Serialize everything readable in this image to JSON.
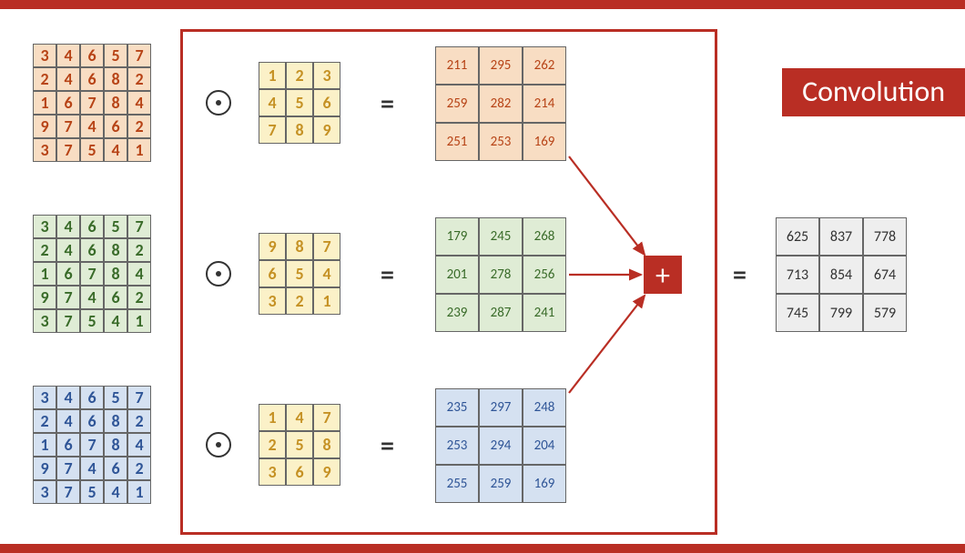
{
  "title": "Convolution",
  "inputs": {
    "channel1": [
      [
        3,
        4,
        6,
        5,
        7
      ],
      [
        2,
        4,
        6,
        8,
        2
      ],
      [
        1,
        6,
        7,
        8,
        4
      ],
      [
        9,
        7,
        4,
        6,
        2
      ],
      [
        3,
        7,
        5,
        4,
        1
      ]
    ],
    "channel2": [
      [
        3,
        4,
        6,
        5,
        7
      ],
      [
        2,
        4,
        6,
        8,
        2
      ],
      [
        1,
        6,
        7,
        8,
        4
      ],
      [
        9,
        7,
        4,
        6,
        2
      ],
      [
        3,
        7,
        5,
        4,
        1
      ]
    ],
    "channel3": [
      [
        3,
        4,
        6,
        5,
        7
      ],
      [
        2,
        4,
        6,
        8,
        2
      ],
      [
        1,
        6,
        7,
        8,
        4
      ],
      [
        9,
        7,
        4,
        6,
        2
      ],
      [
        3,
        7,
        5,
        4,
        1
      ]
    ]
  },
  "kernels": {
    "k1": [
      [
        1,
        2,
        3
      ],
      [
        4,
        5,
        6
      ],
      [
        7,
        8,
        9
      ]
    ],
    "k2": [
      [
        9,
        8,
        7
      ],
      [
        6,
        5,
        4
      ],
      [
        3,
        2,
        1
      ]
    ],
    "k3": [
      [
        1,
        4,
        7
      ],
      [
        2,
        5,
        8
      ],
      [
        3,
        6,
        9
      ]
    ]
  },
  "intermediate": {
    "r1": [
      [
        211,
        295,
        262
      ],
      [
        259,
        282,
        214
      ],
      [
        251,
        253,
        169
      ]
    ],
    "r2": [
      [
        179,
        245,
        268
      ],
      [
        201,
        278,
        256
      ],
      [
        239,
        287,
        241
      ]
    ],
    "r3": [
      [
        235,
        297,
        248
      ],
      [
        253,
        294,
        204
      ],
      [
        255,
        259,
        169
      ]
    ]
  },
  "output": [
    [
      625,
      837,
      778
    ],
    [
      713,
      854,
      674
    ],
    [
      745,
      799,
      579
    ]
  ],
  "ops": {
    "hadamard": "⊙",
    "equals": "=",
    "plus": "+"
  }
}
